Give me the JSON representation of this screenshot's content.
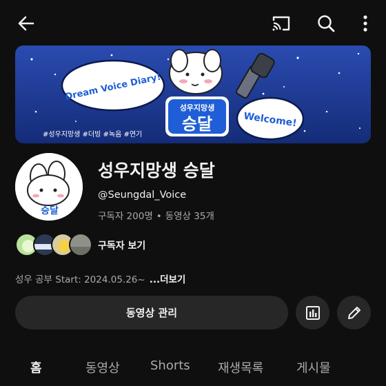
{
  "topbar": {
    "back_icon": "arrow-left-icon",
    "cast_icon": "cast-icon",
    "search_icon": "search-icon",
    "more_icon": "more-vertical-icon"
  },
  "banner": {
    "title_text": "Dream Voice Diary!",
    "welcome_text": "Welcome!",
    "badge_small": "성우지망생",
    "badge_big": "승달",
    "hashtags": "#성우지망생 #더빙 #녹음 #연기"
  },
  "channel": {
    "name": "성우지망생 승달",
    "handle": "@Seungdal_Voice",
    "subscribers": "구독자 200명",
    "separator": "•",
    "videos": "동영상 35개",
    "avatar_caption": "승달"
  },
  "subscribers_row": {
    "label": "구독자 보기"
  },
  "description": {
    "text": "성우 공부 Start: 2024.05.26~",
    "more_label": "...더보기"
  },
  "actions": {
    "manage_label": "동영상 관리",
    "analytics_icon": "analytics-icon",
    "edit_icon": "pencil-icon"
  },
  "tabs": [
    {
      "label": "홈",
      "active": true
    },
    {
      "label": "동영상",
      "active": false
    },
    {
      "label": "Shorts",
      "active": false
    },
    {
      "label": "재생목록",
      "active": false
    },
    {
      "label": "게시물",
      "active": false
    }
  ],
  "colors": {
    "background": "#0f0f0f",
    "surface": "#272727",
    "text_primary": "#f1f1f1",
    "text_secondary": "#aaaaaa",
    "banner_blue": "#1d3b93",
    "badge_blue": "#1f5ed6"
  }
}
